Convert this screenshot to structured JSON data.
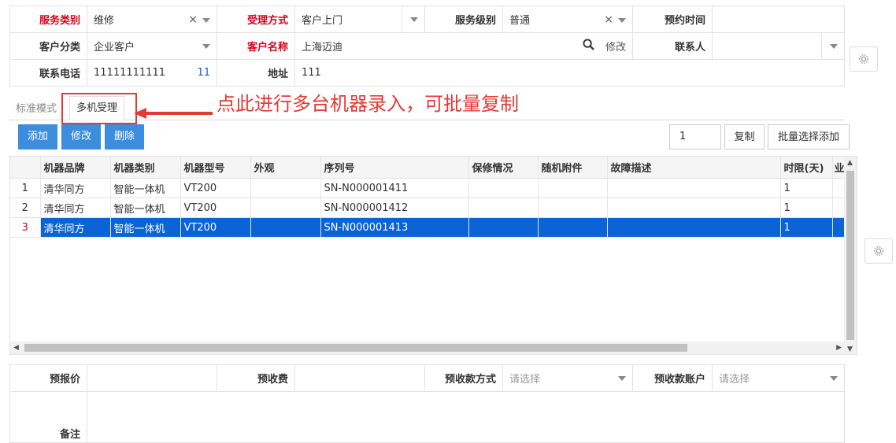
{
  "form": {
    "service_type": {
      "label": "服务类别",
      "value": "维修"
    },
    "accept_method": {
      "label": "受理方式",
      "value": "客户上门"
    },
    "service_level": {
      "label": "服务级别",
      "value": "普通"
    },
    "appointment_time": {
      "label": "预约时间",
      "value": ""
    },
    "customer_category": {
      "label": "客户分类",
      "value": "企业客户"
    },
    "customer_name": {
      "label": "客户名称",
      "value": "上海迈迪",
      "edit": "修改"
    },
    "contact": {
      "label": "联系人",
      "value": ""
    },
    "phone": {
      "label": "联系电话",
      "value": "11111111111",
      "count": "11"
    },
    "address": {
      "label": "地址",
      "value": "111"
    }
  },
  "tabs": [
    {
      "label": "标准模式"
    },
    {
      "label": "多机受理"
    }
  ],
  "annotation": "点此进行多台机器录入，可批量复制",
  "toolbar": {
    "add": "添加",
    "edit": "修改",
    "delete": "删除",
    "copy_count": "1",
    "copy": "复制",
    "batch_add": "批量选择添加"
  },
  "grid": {
    "columns": [
      "机器品牌",
      "机器类别",
      "机器型号",
      "外观",
      "序列号",
      "保修情况",
      "随机附件",
      "故障描述",
      "时限(天)",
      "业"
    ],
    "rows": [
      {
        "num": "1",
        "brand": "清华同方",
        "category": "智能一体机",
        "model": "VT200",
        "appearance": "",
        "serial": "SN-N000001411",
        "warranty": "",
        "accessories": "",
        "fault": "",
        "limit": "1"
      },
      {
        "num": "2",
        "brand": "清华同方",
        "category": "智能一体机",
        "model": "VT200",
        "appearance": "",
        "serial": "SN-N000001412",
        "warranty": "",
        "accessories": "",
        "fault": "",
        "limit": "1"
      },
      {
        "num": "3",
        "brand": "清华同方",
        "category": "智能一体机",
        "model": "VT200",
        "appearance": "",
        "serial": "SN-N000001413",
        "warranty": "",
        "accessories": "",
        "fault": "",
        "limit": "1"
      }
    ]
  },
  "bottom": {
    "quote": {
      "label": "预报价",
      "value": ""
    },
    "prepay": {
      "label": "预收费",
      "value": ""
    },
    "prepay_method": {
      "label": "预收款方式",
      "placeholder": "请选择"
    },
    "prepay_account": {
      "label": "预收款账户",
      "placeholder": "请选择"
    },
    "remark": {
      "label": "备注",
      "value": ""
    }
  },
  "colors": {
    "accent": "#3c8dde",
    "required": "#d9001b",
    "annotation": "#e53935",
    "selected_row": "#0b63d6"
  }
}
